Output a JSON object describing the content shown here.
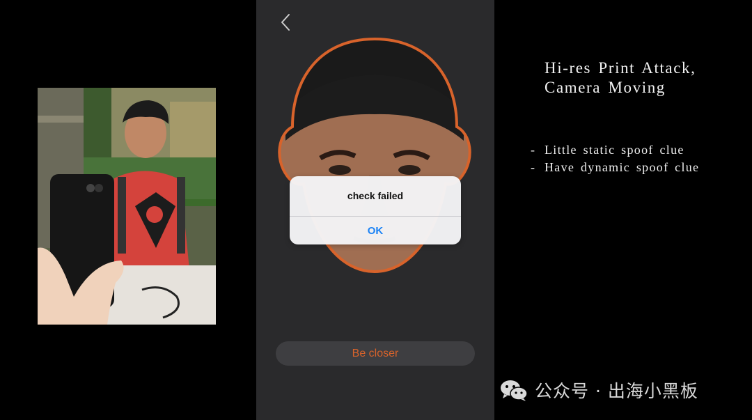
{
  "right_panel": {
    "title_line1": "Hi-res Print Attack,",
    "title_line2": "Camera Moving",
    "bullets": [
      {
        "dash": "-",
        "text": "Little static spoof clue"
      },
      {
        "dash": "-",
        "text": "Have dynamic spoof clue"
      }
    ]
  },
  "phone": {
    "alert": {
      "message": "check failed",
      "ok_label": "OK"
    },
    "hint_label": "Be closer",
    "colors": {
      "frame_orange": "#d8632b",
      "ok_blue": "#1a82f5"
    }
  },
  "watermark": {
    "text": "公众号 · 出海小黑板"
  },
  "icons": {
    "back": "chevron-left-icon",
    "wechat": "wechat-icon"
  }
}
